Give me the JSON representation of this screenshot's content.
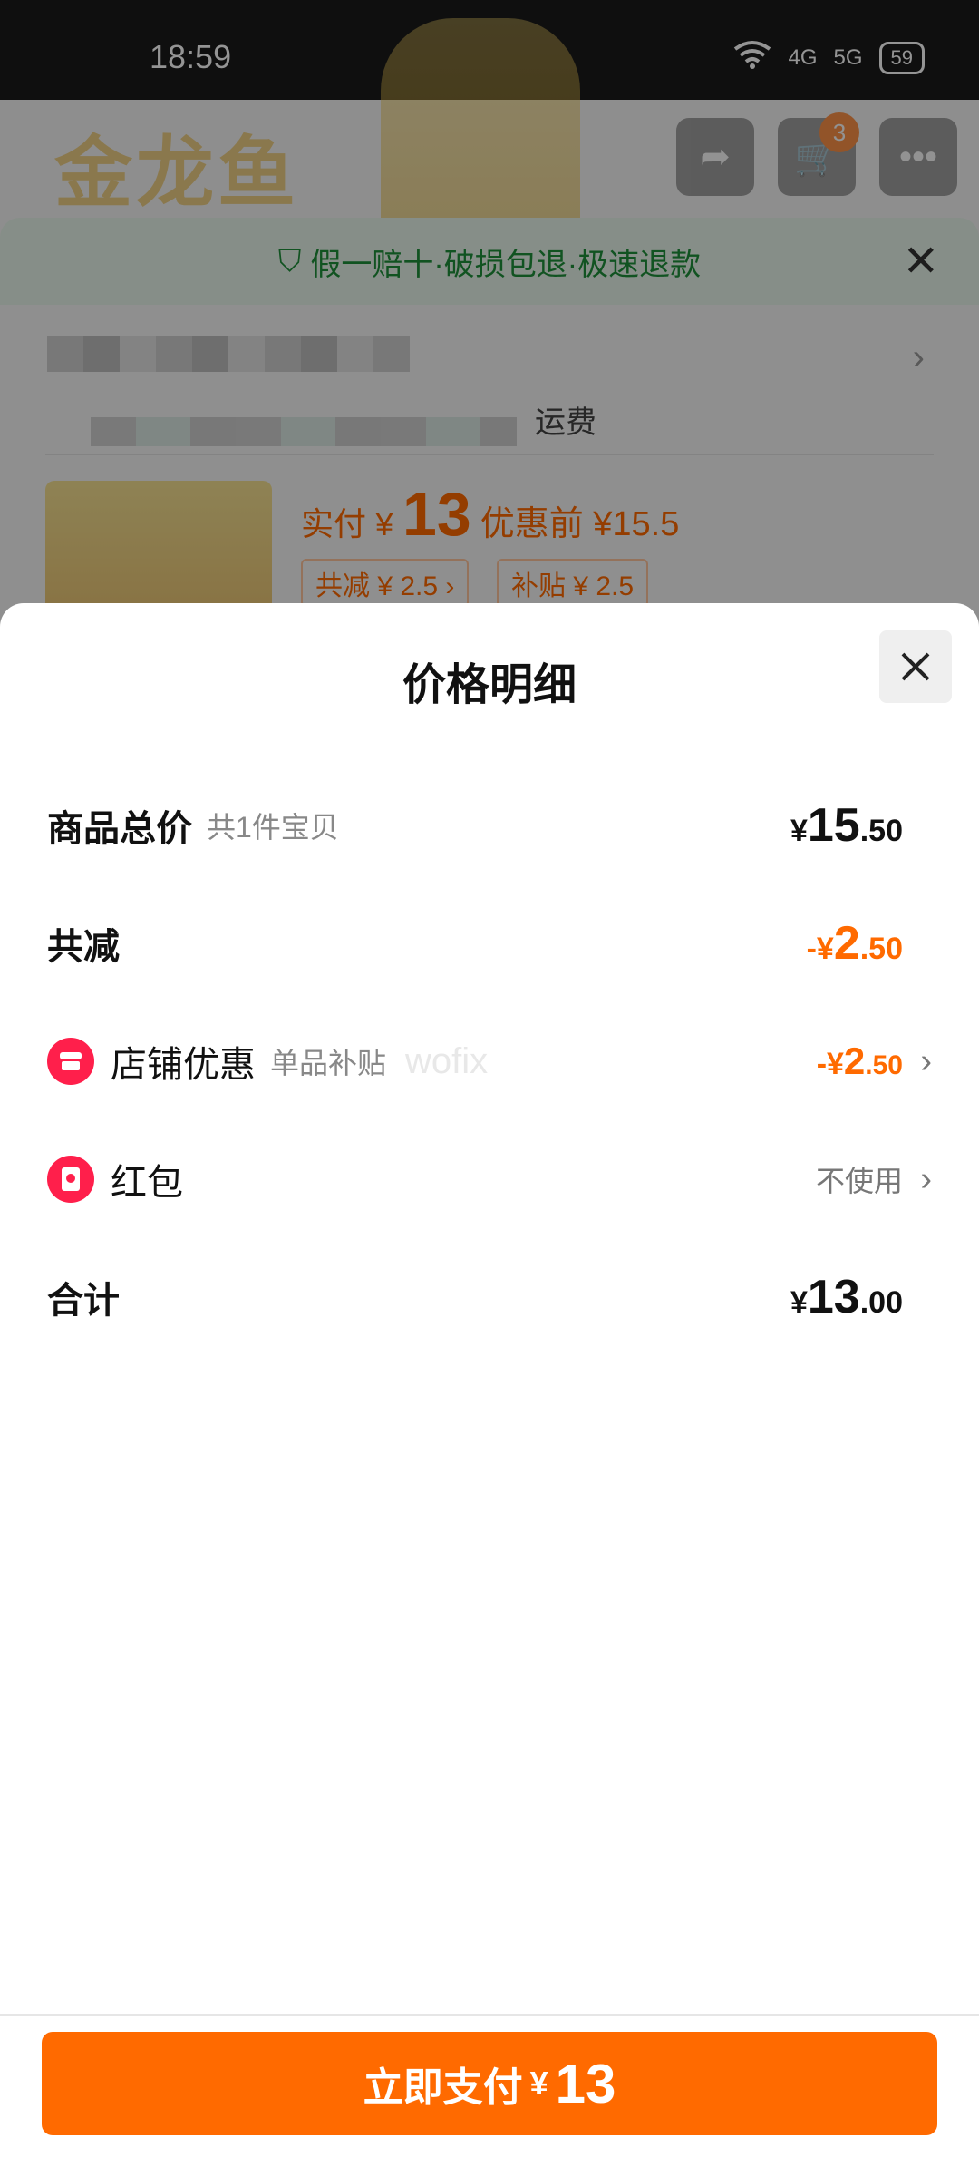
{
  "status_bar": {
    "time": "18:59",
    "signal1": "4G",
    "signal2": "5G",
    "battery": "59"
  },
  "background": {
    "brand_logo": "金龙鱼",
    "cart_count": "3",
    "guarantee_text": "假一赔十·破损包退·极速退款",
    "shipping_label": "运费",
    "paid_label": "实付",
    "paid_currency": "¥",
    "paid_amount": "13",
    "before_discount": "优惠前 ¥15.5",
    "pill_reduce": "共减 ¥ 2.5 ›",
    "pill_subsidy": "补贴 ¥ 2.5"
  },
  "sheet": {
    "title": "价格明细",
    "rows": [
      {
        "label": "商品总价",
        "sub": "共1件宝贝",
        "symbol": "¥",
        "int": "15",
        "dec": ".50"
      },
      {
        "label": "共减",
        "symbol": "-¥",
        "int": "2",
        "dec": ".50"
      },
      {
        "label": "店铺优惠",
        "sub": "单品补贴",
        "symbol": "-¥",
        "int": "2",
        "dec": ".50",
        "watermark": "wofix"
      },
      {
        "label": "红包",
        "status": "不使用"
      },
      {
        "label": "合计",
        "symbol": "¥",
        "int": "13",
        "dec": ".00"
      }
    ],
    "accent_color": "#ff6a00"
  },
  "footer": {
    "pay_label": "立即支付",
    "pay_symbol": "¥",
    "pay_amount": "13"
  }
}
